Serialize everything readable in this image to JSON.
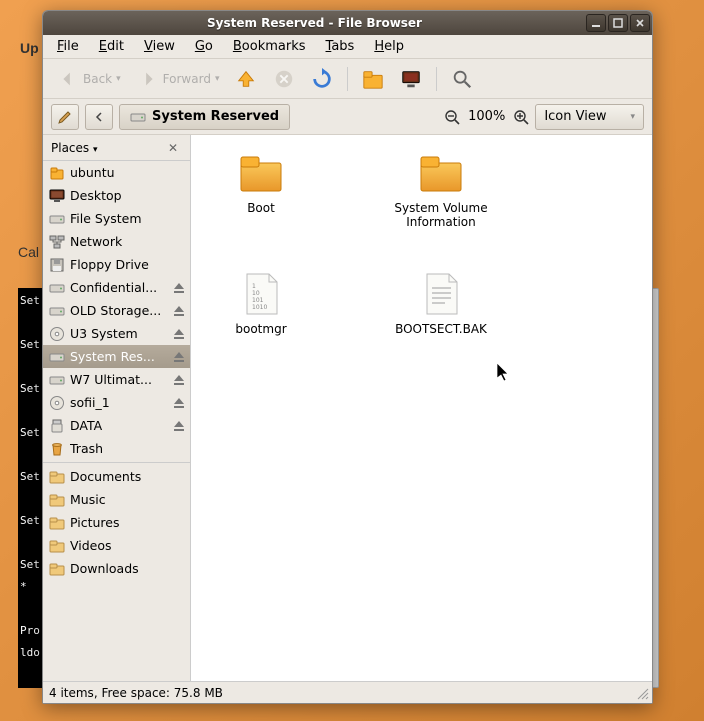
{
  "bg": {
    "up": "Up",
    "cal": "Cal",
    "terminal_lines": [
      "Set",
      "",
      "Set",
      "",
      "Set",
      "",
      "Set",
      "",
      "Set",
      "",
      "Set",
      "",
      "Set",
      " *",
      "",
      "Pro",
      "ldo",
      ""
    ]
  },
  "window": {
    "title": "System Reserved - File Browser",
    "menu": [
      "File",
      "Edit",
      "View",
      "Go",
      "Bookmarks",
      "Tabs",
      "Help"
    ],
    "toolbar": {
      "back": "Back",
      "forward": "Forward"
    },
    "location": "System Reserved",
    "zoom": "100%",
    "view_mode": "Icon View",
    "sidebar": {
      "header": "Places",
      "items": [
        {
          "icon": "home",
          "label": "ubuntu",
          "eject": false
        },
        {
          "icon": "desktop",
          "label": "Desktop",
          "eject": false
        },
        {
          "icon": "drive",
          "label": "File System",
          "eject": false
        },
        {
          "icon": "network",
          "label": "Network",
          "eject": false
        },
        {
          "icon": "floppy",
          "label": "Floppy Drive",
          "eject": false
        },
        {
          "icon": "drive",
          "label": "Confidential...",
          "eject": true
        },
        {
          "icon": "drive",
          "label": "OLD Storage...",
          "eject": true
        },
        {
          "icon": "cd",
          "label": "U3 System",
          "eject": true
        },
        {
          "icon": "drive",
          "label": "System Res...",
          "eject": true,
          "selected": true
        },
        {
          "icon": "drive",
          "label": "W7 Ultimat...",
          "eject": true
        },
        {
          "icon": "cd",
          "label": "sofii_1",
          "eject": true
        },
        {
          "icon": "usb",
          "label": "DATA",
          "eject": true
        },
        {
          "icon": "trash",
          "label": "Trash",
          "eject": false
        }
      ],
      "items2": [
        {
          "icon": "folder",
          "label": "Documents"
        },
        {
          "icon": "folder",
          "label": "Music"
        },
        {
          "icon": "folder",
          "label": "Pictures"
        },
        {
          "icon": "folder",
          "label": "Videos"
        },
        {
          "icon": "folder",
          "label": "Downloads"
        }
      ]
    },
    "content": [
      {
        "type": "folder",
        "label": "Boot"
      },
      {
        "type": "folder",
        "label": "System Volume Information"
      },
      {
        "type": "file-bin",
        "label": "bootmgr"
      },
      {
        "type": "file-text",
        "label": "BOOTSECT.BAK"
      }
    ],
    "status": "4 items, Free space: 75.8 MB"
  }
}
